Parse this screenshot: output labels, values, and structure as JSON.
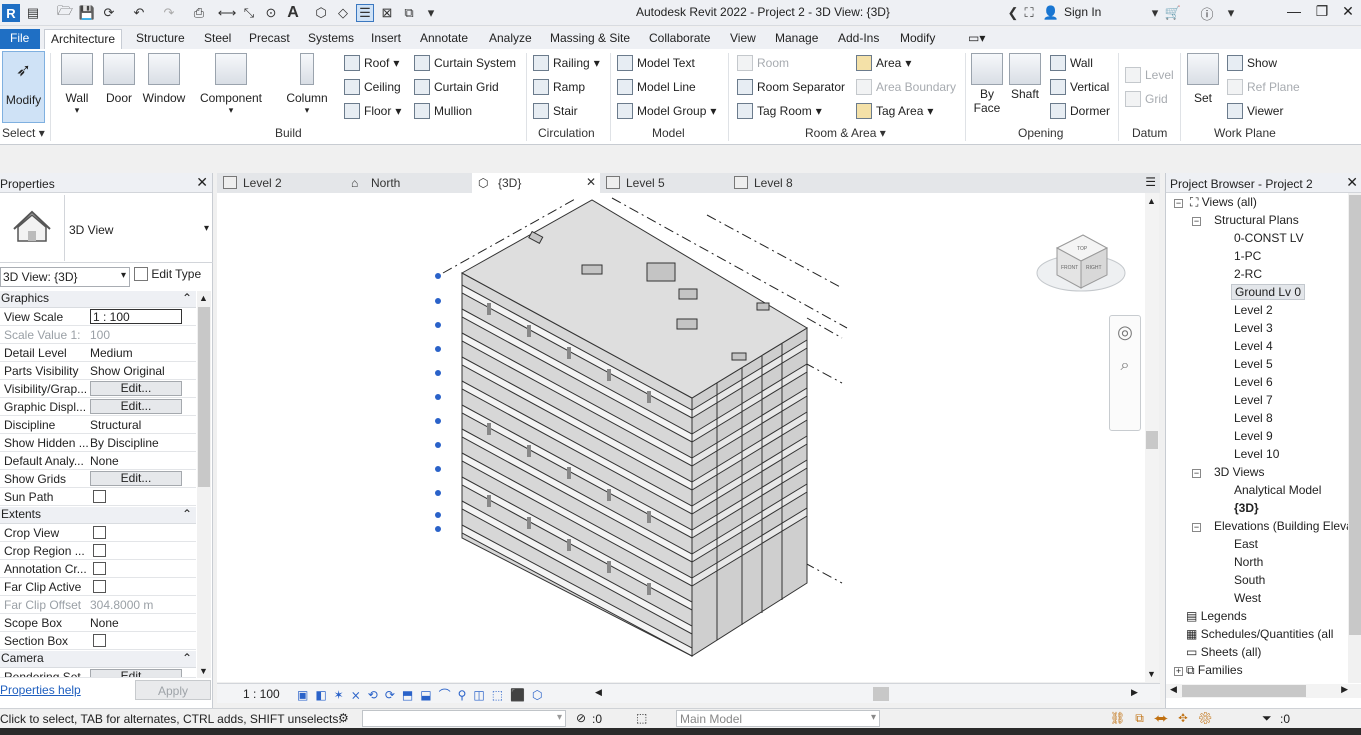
{
  "app": {
    "title": "Autodesk Revit 2022 - Project 2 - 3D View: {3D}",
    "sign_in": "Sign In"
  },
  "ribbon_tabs": [
    "File",
    "Architecture",
    "Structure",
    "Steel",
    "Precast",
    "Systems",
    "Insert",
    "Annotate",
    "Analyze",
    "Massing & Site",
    "Collaborate",
    "View",
    "Manage",
    "Add-Ins",
    "Modify"
  ],
  "active_tab": "Architecture",
  "ribbon": {
    "modify": "Modify",
    "select_label": "Select",
    "build": {
      "wall": "Wall",
      "door": "Door",
      "window": "Window",
      "component": "Component",
      "column": "Column",
      "roof": "Roof",
      "ceiling": "Ceiling",
      "floor": "Floor",
      "curtain_system": "Curtain System",
      "curtain_grid": "Curtain Grid",
      "mullion": "Mullion",
      "label": "Build"
    },
    "circulation": {
      "railing": "Railing",
      "ramp": "Ramp",
      "stair": "Stair",
      "label": "Circulation"
    },
    "model": {
      "model_text": "Model Text",
      "model_line": "Model Line",
      "model_group": "Model Group",
      "label": "Model"
    },
    "room_area": {
      "room": "Room",
      "room_separator": "Room Separator",
      "tag_room": "Tag Room",
      "area": "Area",
      "area_boundary": "Area Boundary",
      "tag_area": "Tag Area",
      "label": "Room & Area"
    },
    "opening": {
      "by_face_1": "By",
      "by_face_2": "Face",
      "shaft": "Shaft",
      "wall": "Wall",
      "vertical": "Vertical",
      "dormer": "Dormer",
      "label": "Opening"
    },
    "datum": {
      "level": "Level",
      "grid": "Grid",
      "label": "Datum"
    },
    "work_plane": {
      "set": "Set",
      "show": "Show",
      "ref_plane": "Ref Plane",
      "viewer": "Viewer",
      "label": "Work Plane"
    }
  },
  "properties": {
    "title": "Properties",
    "type_name": "3D View",
    "view_selector": "3D View: {3D}",
    "edit_type": "Edit Type",
    "groups": {
      "graphics": "Graphics",
      "extents": "Extents",
      "camera": "Camera"
    },
    "rows": [
      {
        "k": "View Scale",
        "v": "1 : 100"
      },
      {
        "k": "Scale Value    1:",
        "v": "100"
      },
      {
        "k": "Detail Level",
        "v": "Medium"
      },
      {
        "k": "Parts Visibility",
        "v": "Show Original"
      },
      {
        "k": "Visibility/Grap...",
        "v": "Edit..."
      },
      {
        "k": "Graphic Displ...",
        "v": "Edit..."
      },
      {
        "k": "Discipline",
        "v": "Structural"
      },
      {
        "k": "Show Hidden ...",
        "v": "By Discipline"
      },
      {
        "k": "Default Analy...",
        "v": "None"
      },
      {
        "k": "Show Grids",
        "v": "Edit..."
      },
      {
        "k": "Sun Path",
        "v": ""
      },
      {
        "k": "Crop View",
        "v": ""
      },
      {
        "k": "Crop Region ...",
        "v": ""
      },
      {
        "k": "Annotation Cr...",
        "v": ""
      },
      {
        "k": "Far Clip Active",
        "v": ""
      },
      {
        "k": "Far Clip Offset",
        "v": "304.8000 m"
      },
      {
        "k": "Scope Box",
        "v": "None"
      },
      {
        "k": "Section Box",
        "v": ""
      },
      {
        "k": "Rendering Set...",
        "v": "Edit..."
      }
    ],
    "help": "Properties help",
    "apply": "Apply"
  },
  "view_tabs": [
    "Level 2",
    "North",
    "{3D}",
    "Level 5",
    "Level 8"
  ],
  "active_view_tab": "{3D}",
  "view_bar": {
    "scale": "1 : 100"
  },
  "browser": {
    "title": "Project Browser - Project 2",
    "views_all": "Views (all)",
    "structural_plans": "Structural Plans",
    "plans": [
      "0-CONST LV",
      "1-PC",
      "2-RC",
      "Ground Lv 0",
      "Level 2",
      "Level 3",
      "Level 4",
      "Level 5",
      "Level 6",
      "Level 7",
      "Level 8",
      "Level 9",
      "Level 10"
    ],
    "selected_plan": "Ground Lv 0",
    "views_3d": "3D Views",
    "views_3d_items": [
      "Analytical Model",
      "{3D}"
    ],
    "elevations": "Elevations (Building Elevati",
    "elevation_items": [
      "East",
      "North",
      "South",
      "West"
    ],
    "legends": "Legends",
    "schedules": "Schedules/Quantities (all",
    "sheets": "Sheets (all)",
    "families": "Families"
  },
  "status": {
    "hint": "Click to select, TAB for alternates, CTRL adds, SHIFT unselects.",
    "filter_count": ":0",
    "model": "Main Model",
    "right_count": ":0"
  },
  "viewcube": {
    "top": "TOP",
    "front": "FRONT",
    "right": "RIGHT"
  }
}
